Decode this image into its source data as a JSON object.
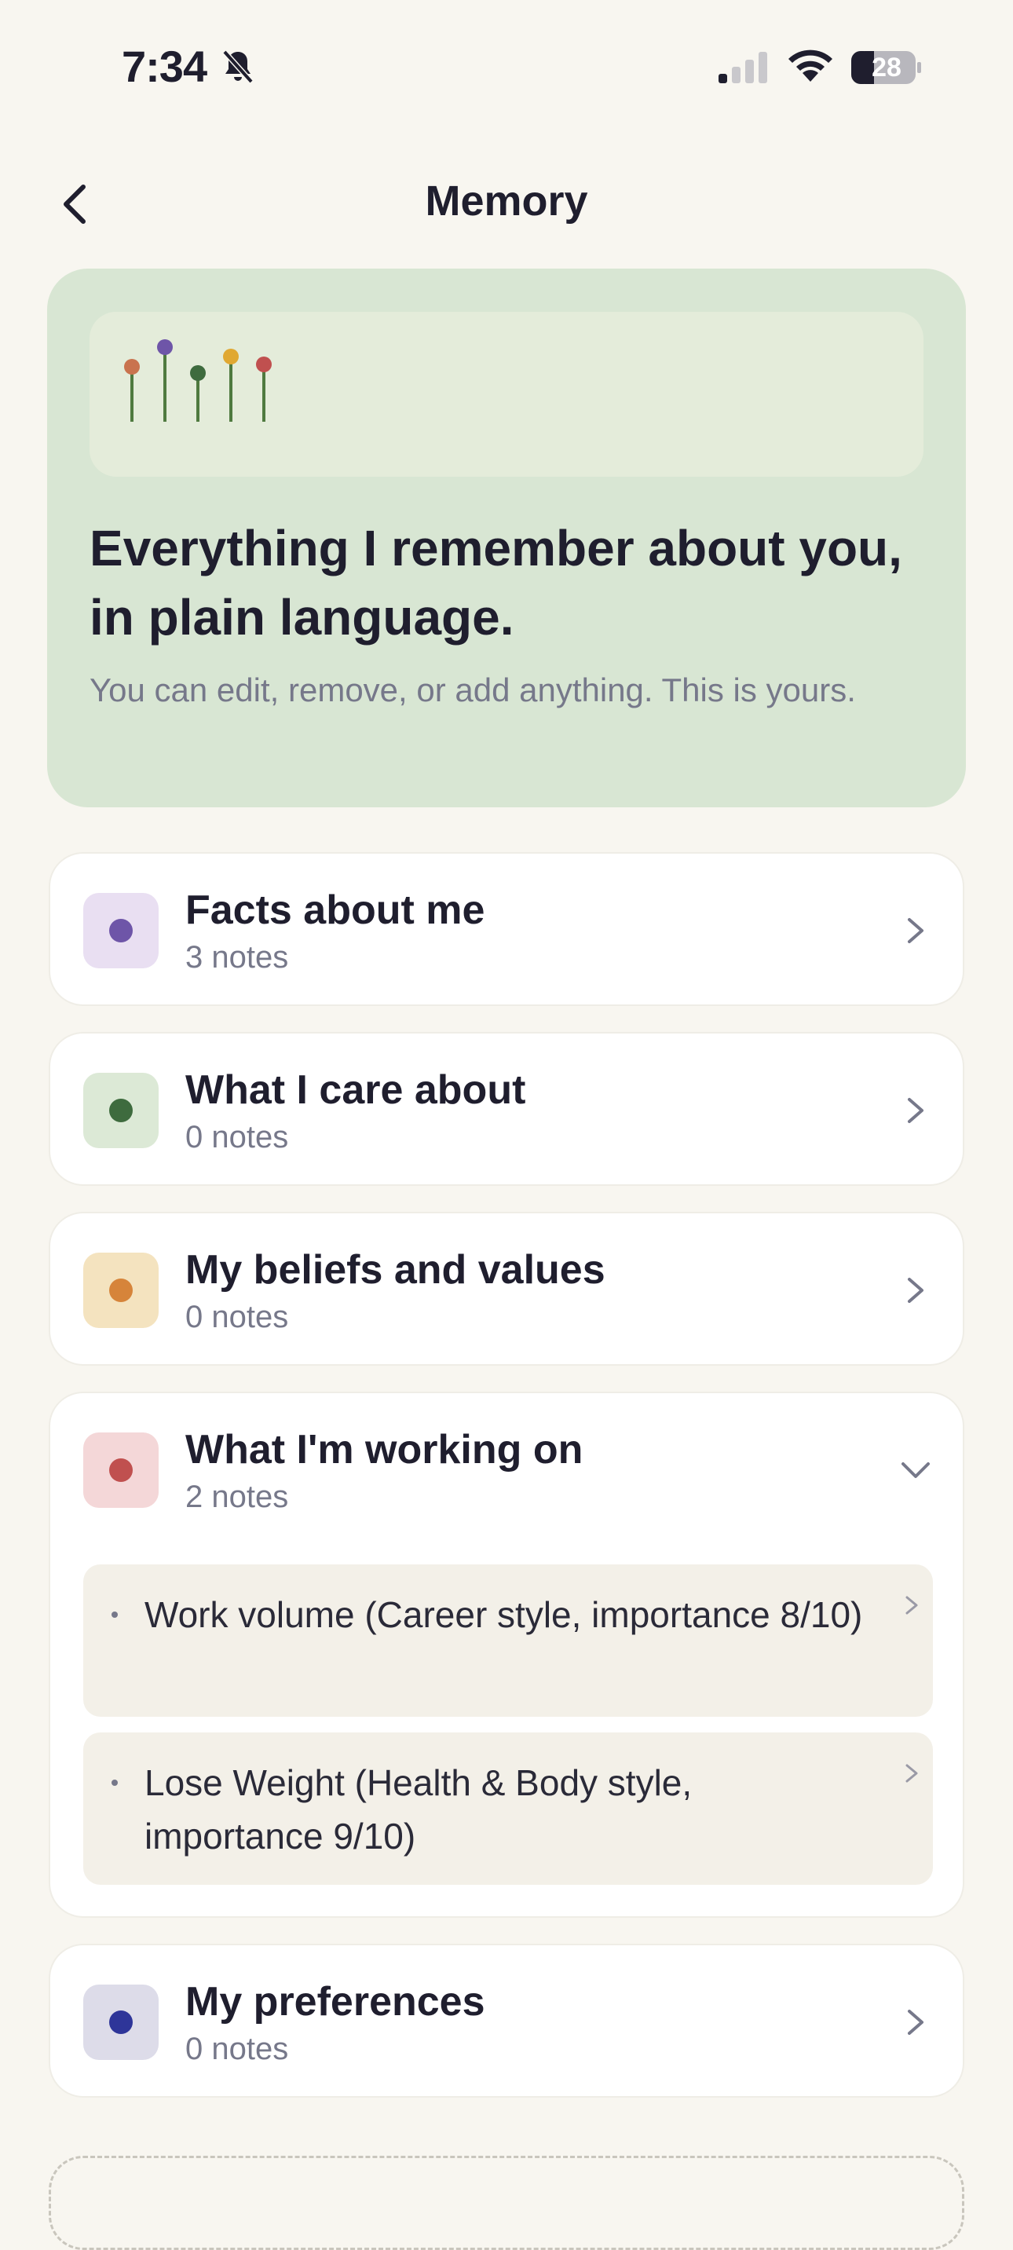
{
  "status_bar": {
    "time": "7:34",
    "battery": "28"
  },
  "header": {
    "title": "Memory"
  },
  "hero": {
    "title": "Everything I remember about you, in plain language.",
    "subtitle": "You can edit, remove, or add anything. This is yours."
  },
  "categories": [
    {
      "title": "Facts about me",
      "count": "3 notes",
      "accent": "#6e55a8",
      "tint": "#e9dff2",
      "expanded": false
    },
    {
      "title": "What I care about",
      "count": "0 notes",
      "accent": "#3e6b3e",
      "tint": "#dce9d6",
      "expanded": false
    },
    {
      "title": "My beliefs and values",
      "count": "0 notes",
      "accent": "#d6843a",
      "tint": "#f4e3bf",
      "expanded": false
    },
    {
      "title": "What I'm working on",
      "count": "2 notes",
      "accent": "#c0504f",
      "tint": "#f4d7d8",
      "expanded": true,
      "items": [
        "Work volume (Career style, importance 8/10)",
        "Lose Weight (Health & Body style, importance 9/10)"
      ]
    },
    {
      "title": "My preferences",
      "count": "0 notes",
      "accent": "#2e3599",
      "tint": "#dddce9",
      "expanded": false
    }
  ],
  "colors": {
    "background": "#f8f6f0",
    "hero_bg": "#d8e6d3",
    "text_primary": "#1f1e2e",
    "text_secondary": "#76788a"
  },
  "icons": {
    "back": "chevron-left-icon",
    "row": "chevron-right-icon",
    "expanded": "chevron-down-icon",
    "silent": "bell-slash-icon"
  }
}
